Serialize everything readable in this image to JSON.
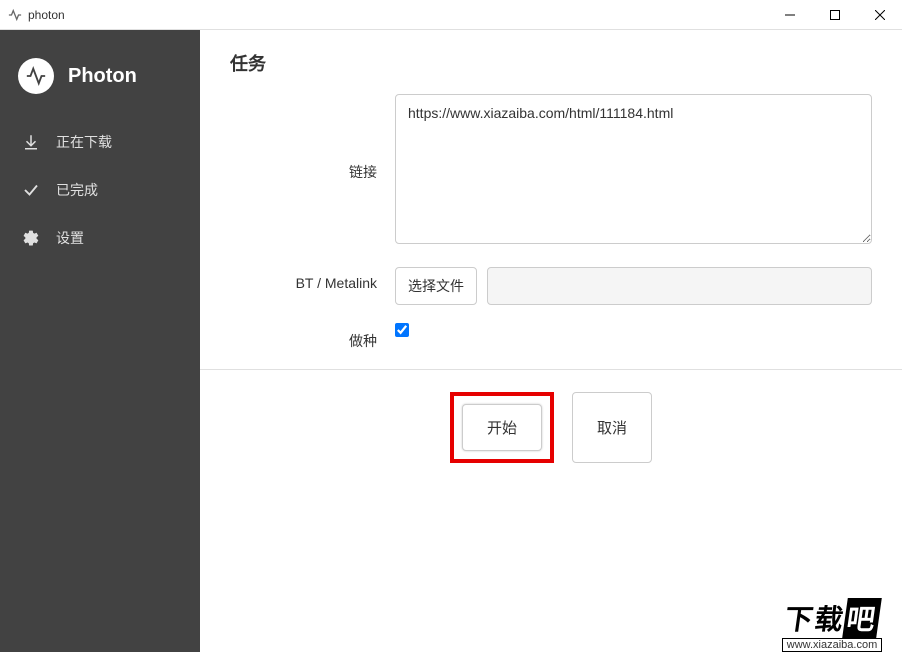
{
  "window": {
    "title": "photon"
  },
  "sidebar": {
    "brand": "Photon",
    "items": [
      {
        "label": "正在下载"
      },
      {
        "label": "已完成"
      },
      {
        "label": "设置"
      }
    ]
  },
  "main": {
    "title": "任务",
    "link_label": "链接",
    "link_value": "https://www.xiazaiba.com/html/111184.html",
    "bt_label": "BT / Metalink",
    "choose_file": "选择文件",
    "seed_label": "做种",
    "seed_checked": true,
    "start_btn": "开始",
    "cancel_btn": "取消"
  },
  "watermark": {
    "text1": "下载",
    "text2": "吧",
    "url": "www.xiazaiba.com"
  }
}
